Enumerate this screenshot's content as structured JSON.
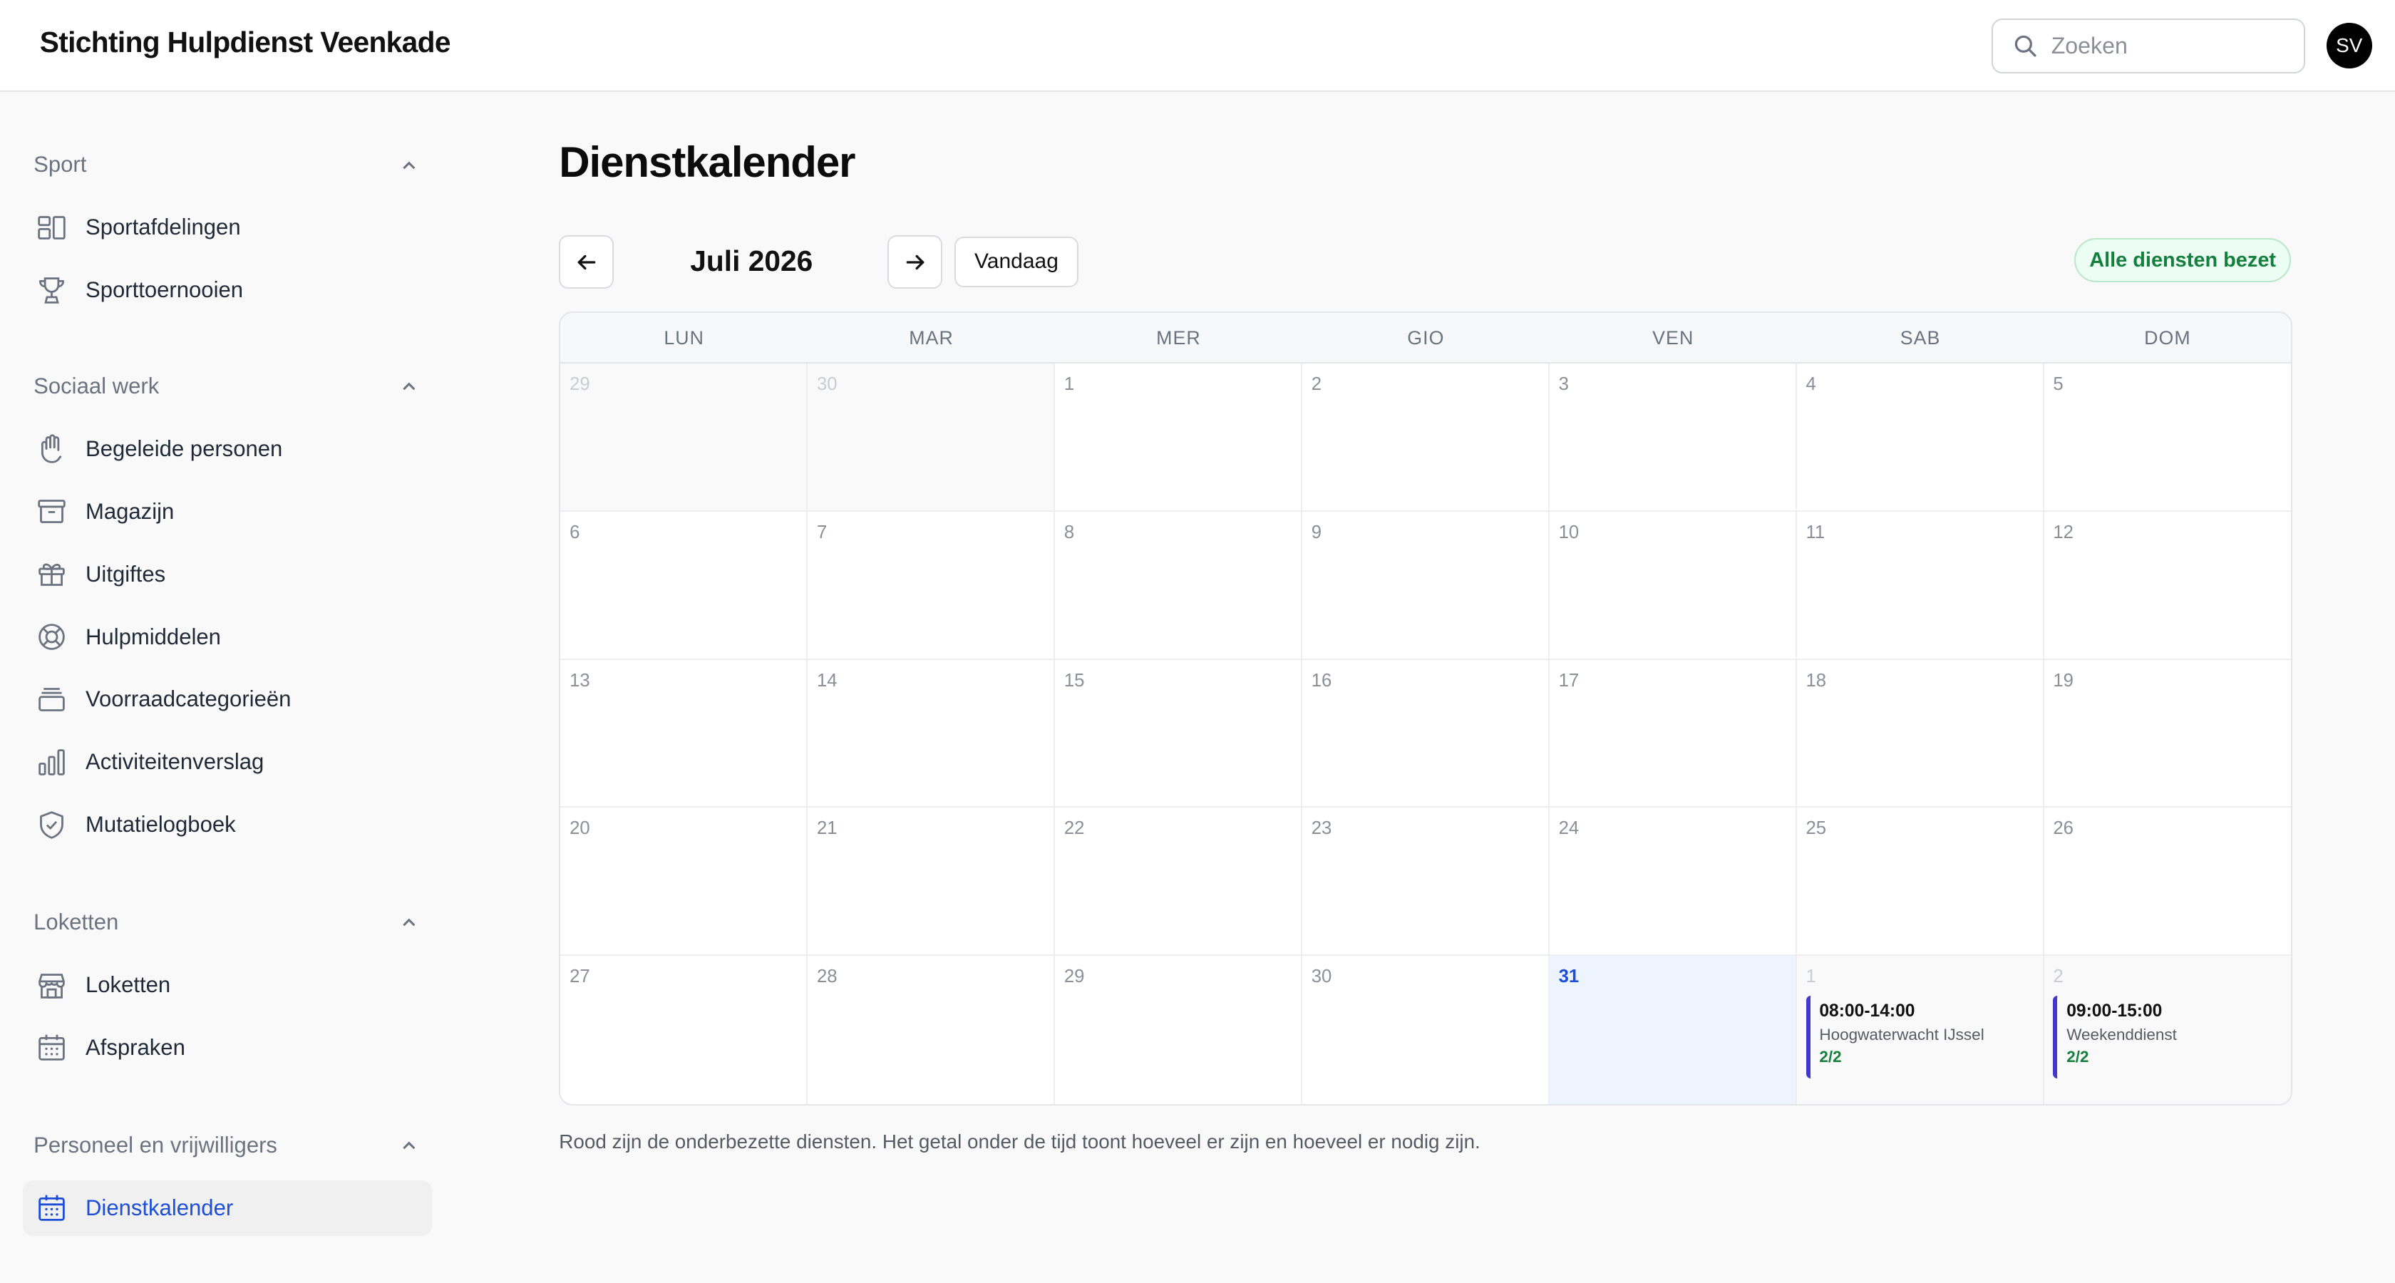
{
  "header": {
    "brand": "Stichting Hulpdienst Veenkade",
    "search_placeholder": "Zoeken",
    "avatar_initials": "SV"
  },
  "sidebar": {
    "groups": [
      {
        "title": "Sport",
        "items": [
          {
            "label": "Sportafdelingen",
            "icon": "grid-icon"
          },
          {
            "label": "Sporttoernooien",
            "icon": "trophy-icon"
          }
        ]
      },
      {
        "title": "Sociaal werk",
        "items": [
          {
            "label": "Begeleide personen",
            "icon": "hand-icon"
          },
          {
            "label": "Magazijn",
            "icon": "archive-box-icon"
          },
          {
            "label": "Uitgiftes",
            "icon": "gift-icon"
          },
          {
            "label": "Hulpmiddelen",
            "icon": "lifebuoy-icon"
          },
          {
            "label": "Voorraadcategorieën",
            "icon": "stack-icon"
          },
          {
            "label": "Activiteitenverslag",
            "icon": "bar-chart-icon"
          },
          {
            "label": "Mutatielogboek",
            "icon": "shield-check-icon"
          }
        ]
      },
      {
        "title": "Loketten",
        "items": [
          {
            "label": "Loketten",
            "icon": "storefront-icon"
          },
          {
            "label": "Afspraken",
            "icon": "calendar-icon"
          }
        ]
      },
      {
        "title": "Personeel en vrijwilligers",
        "items": [
          {
            "label": "Dienstkalender",
            "icon": "calendar-days-icon",
            "active": true
          }
        ]
      }
    ]
  },
  "main": {
    "title": "Dienstkalender",
    "month_label": "Juli 2026",
    "today_button": "Vandaag",
    "status_badge": "Alle diensten bezet",
    "weekdays": [
      "LUN",
      "MAR",
      "MER",
      "GIO",
      "VEN",
      "SAB",
      "DOM"
    ],
    "days": [
      {
        "n": "29",
        "outside": true
      },
      {
        "n": "30",
        "outside": true
      },
      {
        "n": "1"
      },
      {
        "n": "2"
      },
      {
        "n": "3"
      },
      {
        "n": "4"
      },
      {
        "n": "5"
      },
      {
        "n": "6"
      },
      {
        "n": "7"
      },
      {
        "n": "8"
      },
      {
        "n": "9"
      },
      {
        "n": "10"
      },
      {
        "n": "11"
      },
      {
        "n": "12"
      },
      {
        "n": "13"
      },
      {
        "n": "14"
      },
      {
        "n": "15"
      },
      {
        "n": "16"
      },
      {
        "n": "17"
      },
      {
        "n": "18"
      },
      {
        "n": "19"
      },
      {
        "n": "20"
      },
      {
        "n": "21"
      },
      {
        "n": "22"
      },
      {
        "n": "23"
      },
      {
        "n": "24"
      },
      {
        "n": "25"
      },
      {
        "n": "26"
      },
      {
        "n": "27"
      },
      {
        "n": "28"
      },
      {
        "n": "29"
      },
      {
        "n": "30"
      },
      {
        "n": "31",
        "today": true
      },
      {
        "n": "1",
        "outside": true,
        "event": {
          "time": "08:00-14:00",
          "name": "Hoogwaterwacht IJssel",
          "count": "2/2"
        }
      },
      {
        "n": "2",
        "outside": true,
        "event": {
          "time": "09:00-15:00",
          "name": "Weekenddienst",
          "count": "2/2"
        }
      }
    ],
    "footnote": "Rood zijn de onderbezette diensten. Het getal onder de tijd toont hoeveel er zijn en hoeveel er nodig zijn."
  },
  "colors": {
    "accent": "#1d4ed8",
    "event_bar": "#4338ca",
    "status_green": "#15803d",
    "today_bg": "#eef4fd"
  }
}
